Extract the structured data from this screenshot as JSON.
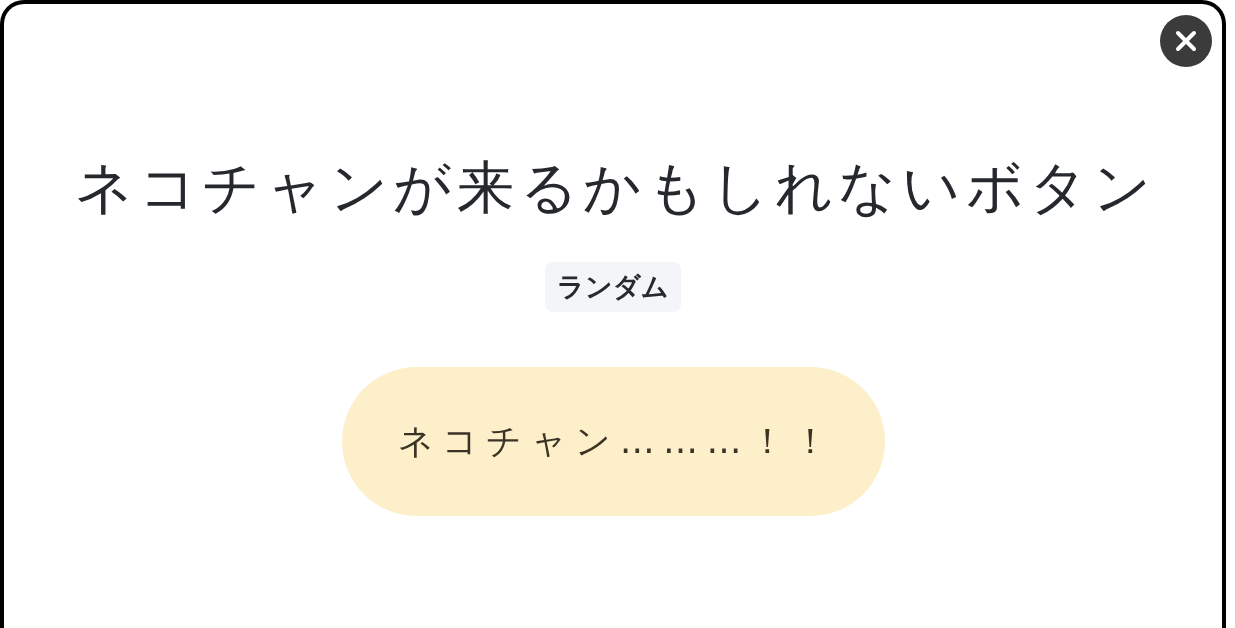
{
  "title": "ネコチャンが来るかもしれないボタン",
  "tag": "ランダム",
  "button": {
    "label": "ネコチャン………！！"
  }
}
